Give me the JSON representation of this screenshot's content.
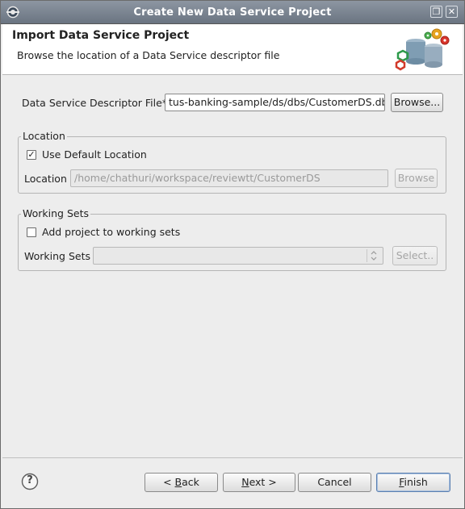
{
  "window": {
    "title": "Create New Data Service Project",
    "app_icon": "eclipse-icon",
    "controls": [
      "maximize-icon",
      "close-icon"
    ],
    "maximize_glyph": "❐",
    "close_glyph": "✕"
  },
  "header": {
    "title": "Import Data Service Project",
    "description": "Browse the location of a Data Service descriptor file",
    "graphic": "data-service-wizard-graphic"
  },
  "descriptor": {
    "label": "Data Service Descriptor File*",
    "value": "tus-banking-sample/ds/dbs/CustomerDS.dbs",
    "browse_label": "Browse..."
  },
  "location_group": {
    "title": "Location",
    "use_default_label": "Use Default Location",
    "use_default_checked": true,
    "location_label": "Location",
    "location_value": "/home/chathuri/workspace/reviewtt/CustomerDS",
    "browse_label": "Browse"
  },
  "working_sets_group": {
    "title": "Working Sets",
    "add_label": "Add project to working sets",
    "add_checked": false,
    "working_sets_label": "Working Sets",
    "working_sets_value": "",
    "select_label": "Select.."
  },
  "footer": {
    "help_icon": "help-icon",
    "help_glyph": "?",
    "back_pre": "< ",
    "back_mnemonic": "B",
    "back_post": "ack",
    "next_mnemonic": "N",
    "next_post": "ext >",
    "cancel_label": "Cancel",
    "finish_mnemonic": "F",
    "finish_post": "inish"
  },
  "colors": {
    "titlebar": "#7a8390",
    "window_bg": "#ededed",
    "disabled_text": "#9a9a9a",
    "default_button_border": "#5a7fb0"
  }
}
